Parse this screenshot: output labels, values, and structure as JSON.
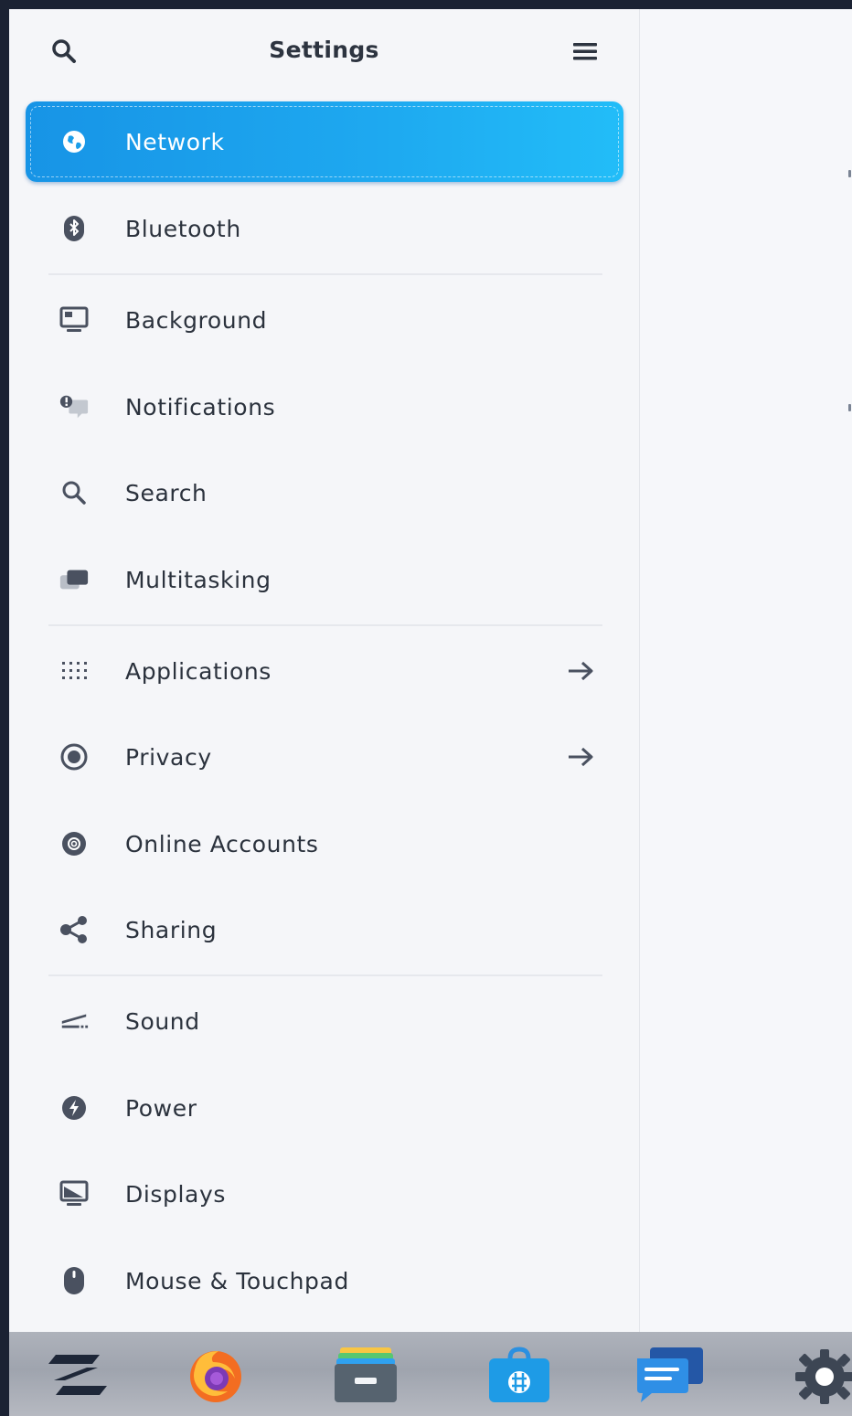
{
  "header": {
    "title": "Settings",
    "search_icon": "search-icon",
    "menu_icon": "hamburger-menu-icon"
  },
  "sidebar": {
    "items": [
      {
        "label": "Network",
        "icon": "globe-icon",
        "active": true
      },
      {
        "label": "Bluetooth",
        "icon": "bluetooth-icon"
      },
      {
        "label": "Background",
        "icon": "monitor-icon"
      },
      {
        "label": "Notifications",
        "icon": "notifications-icon"
      },
      {
        "label": "Search",
        "icon": "search-icon"
      },
      {
        "label": "Multitasking",
        "icon": "multitasking-icon"
      },
      {
        "label": "Applications",
        "icon": "grid-dots-icon",
        "has_arrow": true
      },
      {
        "label": "Privacy",
        "icon": "privacy-icon",
        "has_arrow": true
      },
      {
        "label": "Online Accounts",
        "icon": "at-sign-icon"
      },
      {
        "label": "Sharing",
        "icon": "share-icon"
      },
      {
        "label": "Sound",
        "icon": "sound-icon"
      },
      {
        "label": "Power",
        "icon": "power-icon"
      },
      {
        "label": "Displays",
        "icon": "display-icon"
      },
      {
        "label": "Mouse & Touchpad",
        "icon": "mouse-icon"
      }
    ]
  },
  "dock": {
    "apps": [
      "zorin-menu-icon",
      "firefox-icon",
      "files-icon",
      "software-store-icon",
      "messages-icon",
      "settings-gear-icon"
    ]
  },
  "colors": {
    "accent": "#1ea9f0",
    "text": "#2b323d",
    "icon": "#4a5160",
    "dock": "#a7abb4"
  }
}
